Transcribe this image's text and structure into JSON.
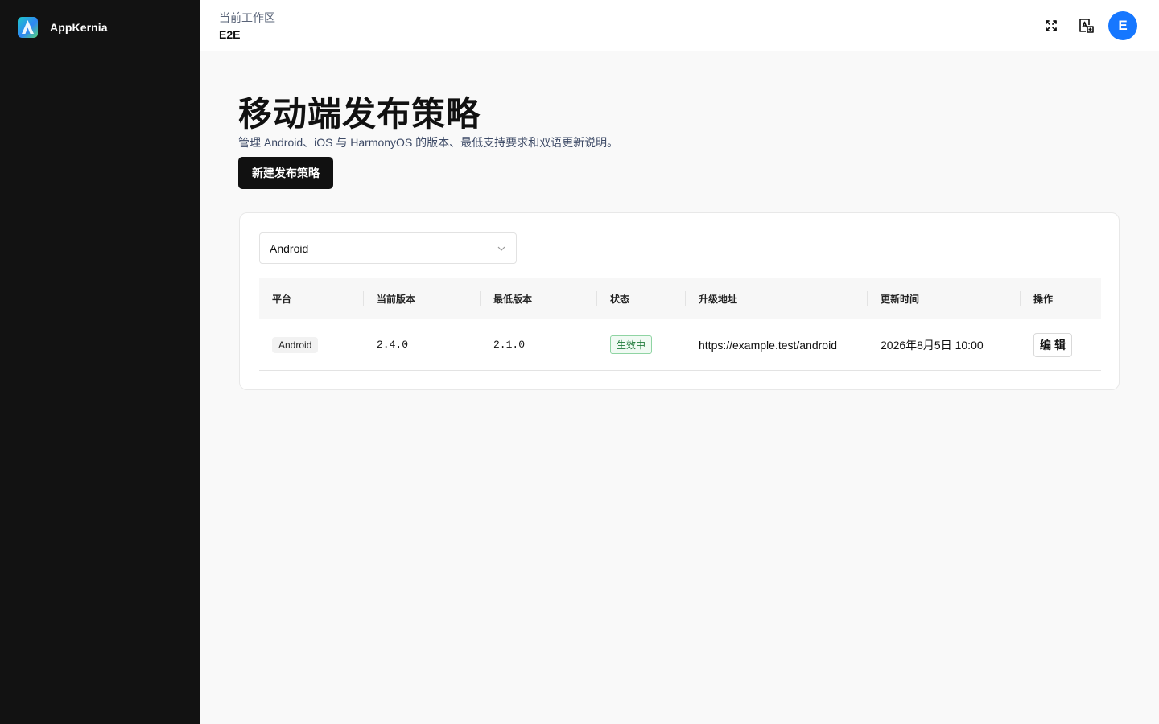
{
  "app": {
    "name": "AppKernia"
  },
  "header": {
    "workspace_label": "当前工作区",
    "workspace_name": "E2E",
    "avatar_initial": "E"
  },
  "page": {
    "title": "移动端发布策略",
    "description": "管理 Android、iOS 与 HarmonyOS 的版本、最低支持要求和双语更新说明。",
    "create_button": "新建发布策略"
  },
  "filter": {
    "platform_selected": "Android"
  },
  "table": {
    "columns": [
      "平台",
      "当前版本",
      "最低版本",
      "状态",
      "升级地址",
      "更新时间",
      "操作"
    ],
    "rows": [
      {
        "platform": "Android",
        "current_version": "2.4.0",
        "min_version": "2.1.0",
        "status": "生效中",
        "upgrade_url": "https://example.test/android",
        "updated_at": "2026年8月5日 10:00",
        "action": "编辑"
      }
    ]
  },
  "colors": {
    "sidebar_bg": "#121212",
    "primary": "#111111",
    "avatar": "#1677ff",
    "status_active": "#1f7a3a"
  },
  "icons": [
    "fullscreen-icon",
    "translate-icon",
    "chevron-down-icon"
  ]
}
